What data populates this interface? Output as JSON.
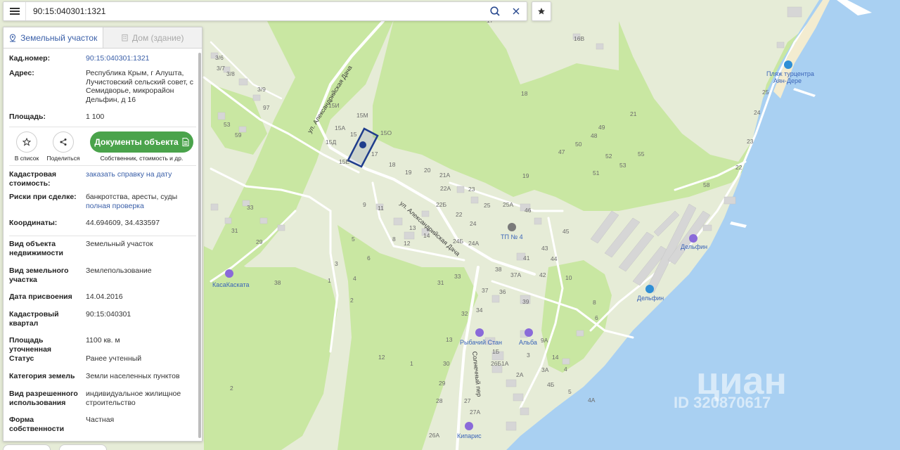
{
  "search": {
    "value": "90:15:040301:1321"
  },
  "tabs": [
    {
      "label": "Земельный участок",
      "active": true
    },
    {
      "label": "Дом (здание)",
      "active": false
    }
  ],
  "info_top": [
    {
      "key": "Кад.номер:",
      "value": "90:15:040301:1321",
      "link": true
    },
    {
      "key": "Адрес:",
      "value": "Республика Крым, г Алушта, Лучистовский сельский совет, с Семидворье, микрорайон Дельфин, д 16",
      "link": false
    },
    {
      "key": "Площадь:",
      "value": "1 100",
      "link": false
    }
  ],
  "actions": {
    "add_to_list": "В список",
    "share": "Поделиться",
    "documents_button": "Документы объекта",
    "documents_sub": "Собственник, стоимость и др."
  },
  "cadastral_value": {
    "key": "Кадастровая стоимость:",
    "link": "заказать справку на дату"
  },
  "risks": {
    "key": "Риски при сделке:",
    "text": "банкротства, аресты, суды",
    "link": "полная проверка"
  },
  "coordinates": {
    "key": "Координаты:",
    "value": "44.694609, 34.433597"
  },
  "details": [
    {
      "key": "Вид объекта недвижимости",
      "value": "Земельный участок"
    },
    {
      "key": "Вид земельного участка",
      "value": "Землепользование"
    },
    {
      "key": "Дата присвоения",
      "value": "14.04.2016"
    },
    {
      "key": "Кадастровый квартал",
      "value": "90:15:040301"
    },
    {
      "key": "Площадь уточненная",
      "value": "1100 кв. м"
    },
    {
      "key": "Статус",
      "value": "Ранее учтенный"
    },
    {
      "key": "Категория земель",
      "value": "Земли населенных пунктов"
    },
    {
      "key": "Вид разрешенного использования",
      "value": "индивидуальное жилищное строительство"
    },
    {
      "key": "Форма собственности",
      "value": "Частная"
    }
  ],
  "map": {
    "streets": [
      "ул. Александрийская Дача",
      "ул. Александрийская Дача",
      "Солнечный пер"
    ],
    "pois": [
      "Пляж турцентра",
      "Аян-Дере",
      "КасаКаската",
      "ТП № 4",
      "Дельфин",
      "Дельфин",
      "Рыбачий Стан",
      "Альба",
      "Кипарис"
    ],
    "house_numbers": [
      "17",
      "16В",
      "3/6",
      "3/7",
      "3/8",
      "3/9",
      "97",
      "53",
      "59",
      "15И",
      "15М",
      "15А",
      "15",
      "15О",
      "15Д",
      "17",
      "15Е",
      "18",
      "19",
      "20",
      "21А",
      "22А",
      "22Б",
      "22",
      "23",
      "25",
      "25А",
      "46",
      "24",
      "24Б",
      "24А",
      "13",
      "14",
      "12",
      "8",
      "11",
      "9",
      "5",
      "6",
      "3",
      "1",
      "4",
      "2",
      "33",
      "31",
      "29",
      "38",
      "18",
      "21",
      "49",
      "50",
      "47",
      "48",
      "52",
      "53",
      "55",
      "51",
      "19",
      "25",
      "24",
      "23",
      "22",
      "58",
      "45",
      "43",
      "44",
      "42",
      "41",
      "38",
      "36",
      "37",
      "37А",
      "39",
      "34",
      "32",
      "33",
      "31",
      "10",
      "8",
      "6",
      "9А",
      "14",
      "13",
      "30",
      "29",
      "28",
      "27",
      "27А",
      "26А",
      "26Б",
      "1Б",
      "1А",
      "2А",
      "3А",
      "4",
      "4Б",
      "4А",
      "5",
      "3",
      "2",
      "1",
      "12"
    ],
    "watermark": "циан",
    "watermark_id": "ID 320870617",
    "colors": {
      "land": "#e6ecd7",
      "forest": "#c9e7a2",
      "sea": "#a9d0f2",
      "roads": "#ffffff",
      "buildings": "#d6d6d6",
      "parcel_outline": "#1f3d8c",
      "button_green": "#4aa34b",
      "link": "#3a5fa8"
    }
  }
}
